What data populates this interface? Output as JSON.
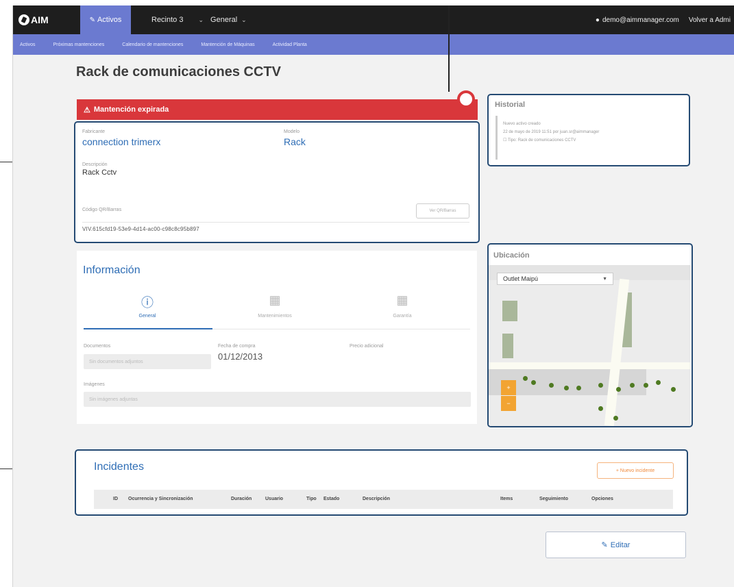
{
  "topbar": {
    "logo_text": "AIM",
    "active_tab": "Activos",
    "nav_items": [
      "Recinto 3",
      "General"
    ],
    "user_email": "demo@aimmanager.com",
    "back_link": "Volver a Admi"
  },
  "subnav": [
    "Activos",
    "Próximas mantenciones",
    "Calendario de mantenciones",
    "Mantención de Máquinas",
    "Actividad Planta"
  ],
  "page": {
    "title": "Rack de comunicaciones CCTV"
  },
  "alert": {
    "text": "Mantención expirada"
  },
  "asset": {
    "manufacturer_label": "Fabricante",
    "manufacturer": "connection trimerx",
    "model_label": "Modelo",
    "model": "Rack",
    "description_label": "Descripción",
    "description": "Rack Cctv",
    "code_label": "Código QR/Barras",
    "code_button": "Ver QR/Barras",
    "code_value": "VIV.615cfd19-53e9-4d14-ac00-c98c8c95b897"
  },
  "historial": {
    "title": "Historial",
    "lines": [
      "Nuevo activo creado",
      "22 de mayo de 2019 11:51 por juan.sr@aimmanager",
      "☐ Tipo: Rack de comunicaciones CCTV"
    ]
  },
  "informacion": {
    "title": "Información",
    "tabs": [
      {
        "label": "General",
        "icon": "info-icon",
        "active": true
      },
      {
        "label": "Mantenimientos",
        "icon": "calendar-icon",
        "active": false
      },
      {
        "label": "Garantía",
        "icon": "calendar-icon",
        "active": false
      }
    ],
    "documents_label": "Documentos",
    "documents_placeholder": "Sin documentos adjuntos",
    "purchase_date_label": "Fecha de compra",
    "purchase_date": "01/12/2013",
    "supplier_label": "Precio adicional",
    "images_label": "Imágenes",
    "images_placeholder": "Sin imágenes adjuntas"
  },
  "ubicacion": {
    "title": "Ubicación",
    "selected_site": "Outlet Maipú"
  },
  "incidentes": {
    "title": "Incidentes",
    "new_button": "+ Nuevo incidente",
    "columns": [
      "ID",
      "Ocurrencia y Sincronización",
      "Duración",
      "Usuario",
      "Tipo",
      "Estado",
      "Descripción",
      "Items",
      "Seguimiento",
      "Opciones"
    ]
  },
  "actions": {
    "edit_label": "Editar"
  },
  "colors": {
    "navbar": "#1e1e1e",
    "accent": "#6b7ad0",
    "alert": "#d9373b",
    "highlight": "#244a73",
    "link": "#2e6db5"
  }
}
